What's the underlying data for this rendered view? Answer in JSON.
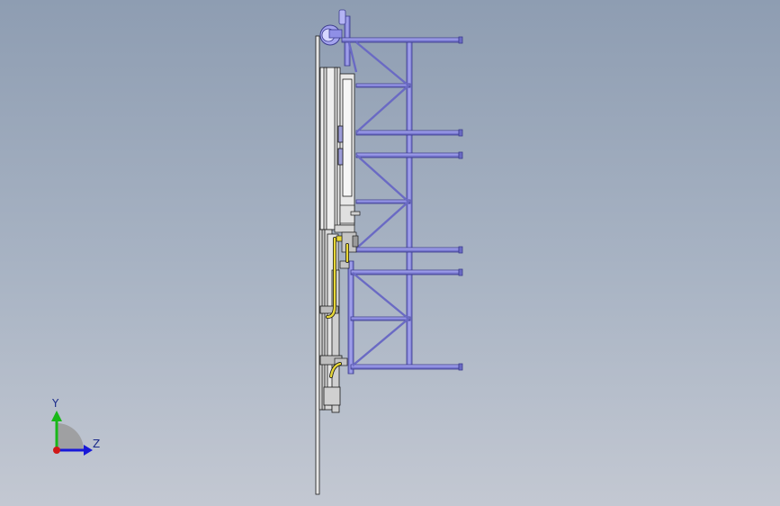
{
  "colors": {
    "background_top": "#8e9db2",
    "background_bottom": "#c3c8d2",
    "frame_blue": "#8f8fe6",
    "frame_blue_dark": "#3d3d8f",
    "wall_gray": "#e6e6e6",
    "edge": "#1a1a1a",
    "hose_yellow": "#e8d838",
    "axis_x": "#d01818",
    "axis_y": "#18b818",
    "axis_z": "#1818d8",
    "axis_label": "#1a2a8a"
  },
  "triad": {
    "y_label": "Y",
    "z_label": "Z"
  },
  "icons": [
    "coordinate-triad-icon"
  ]
}
